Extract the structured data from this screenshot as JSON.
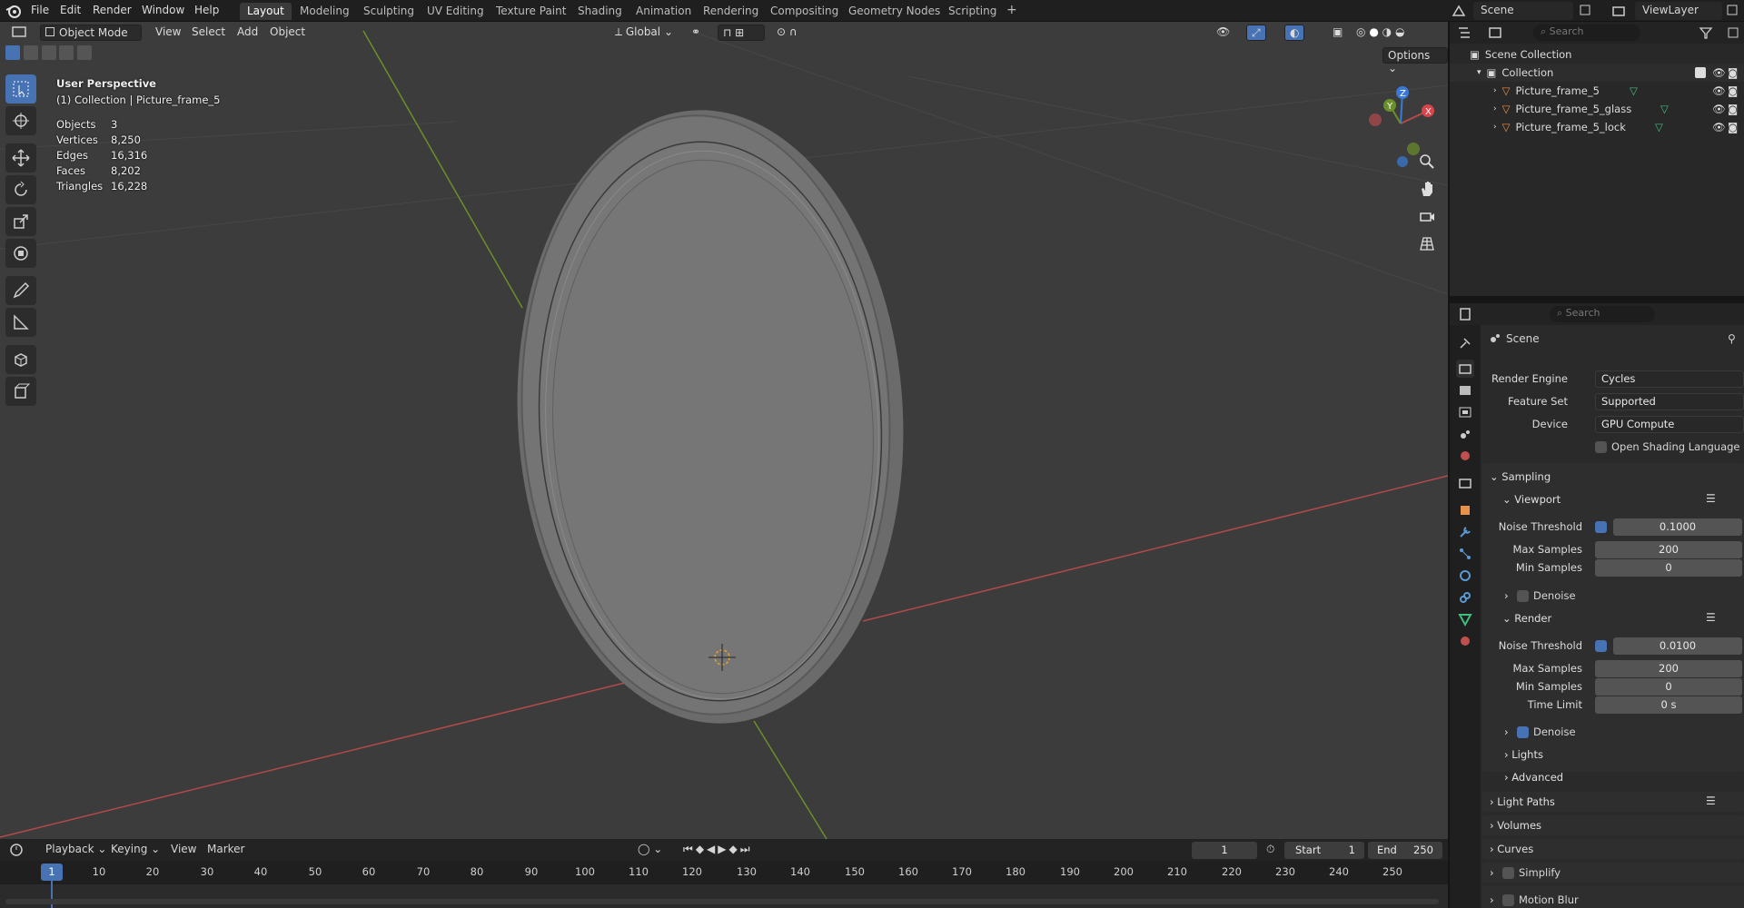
{
  "topbar": {
    "menus": [
      "File",
      "Edit",
      "Render",
      "Window",
      "Help"
    ],
    "workspaces": [
      "Layout",
      "Modeling",
      "Sculpting",
      "UV Editing",
      "Texture Paint",
      "Shading",
      "Animation",
      "Rendering",
      "Compositing",
      "Geometry Nodes",
      "Scripting"
    ],
    "active_workspace": "Layout",
    "add_tab": "+",
    "scene_label": "Scene",
    "viewlayer_label": "ViewLayer"
  },
  "viewport": {
    "mode": "Object Mode",
    "menus": [
      "View",
      "Select",
      "Add",
      "Object"
    ],
    "orientation": "Global",
    "options_label": "Options",
    "perspective": "User Perspective",
    "collection_info": "(1) Collection | Picture_frame_5",
    "stats": [
      {
        "label": "Objects",
        "value": "3"
      },
      {
        "label": "Vertices",
        "value": "8,250"
      },
      {
        "label": "Edges",
        "value": "16,316"
      },
      {
        "label": "Faces",
        "value": "8,202"
      },
      {
        "label": "Triangles",
        "value": "16,228"
      }
    ],
    "gizmo": {
      "x": "X",
      "y": "Y",
      "z": "Z"
    }
  },
  "outliner": {
    "search_placeholder": "Search",
    "scene_collection": "Scene Collection",
    "collection": "Collection",
    "objects": [
      "Picture_frame_5",
      "Picture_frame_5_glass",
      "Picture_frame_5_lock"
    ]
  },
  "properties": {
    "search_placeholder": "Search",
    "context": "Scene",
    "render_engine_label": "Render Engine",
    "render_engine": "Cycles",
    "feature_set_label": "Feature Set",
    "feature_set": "Supported",
    "device_label": "Device",
    "device": "GPU Compute",
    "osl_label": "Open Shading Language",
    "sampling": "Sampling",
    "viewport_section": "Viewport",
    "vp_noise_label": "Noise Threshold",
    "vp_noise": "0.1000",
    "vp_max_label": "Max Samples",
    "vp_max": "200",
    "vp_min_label": "Min Samples",
    "vp_min": "0",
    "vp_denoise": "Denoise",
    "render_section": "Render",
    "r_noise_label": "Noise Threshold",
    "r_noise": "0.0100",
    "r_max_label": "Max Samples",
    "r_max": "200",
    "r_min_label": "Min Samples",
    "r_min": "0",
    "r_time_label": "Time Limit",
    "r_time": "0 s",
    "r_denoise": "Denoise",
    "lights": "Lights",
    "advanced": "Advanced",
    "light_paths": "Light Paths",
    "volumes": "Volumes",
    "curves": "Curves",
    "simplify": "Simplify",
    "motion_blur": "Motion Blur"
  },
  "timeline": {
    "menus": [
      "Playback",
      "Keying",
      "View",
      "Marker"
    ],
    "current_frame": "1",
    "start_label": "Start",
    "start": "1",
    "end_label": "End",
    "end": "250",
    "ticks": [
      "1",
      "10",
      "20",
      "30",
      "40",
      "50",
      "60",
      "70",
      "80",
      "90",
      "100",
      "110",
      "120",
      "130",
      "140",
      "150",
      "160",
      "170",
      "180",
      "190",
      "200",
      "210",
      "220",
      "230",
      "240",
      "250"
    ]
  },
  "colors": {
    "accent": "#4772b3",
    "x_axis": "#b34a4a",
    "y_axis": "#6b8f2a",
    "z_axis": "#3a7ad6"
  }
}
